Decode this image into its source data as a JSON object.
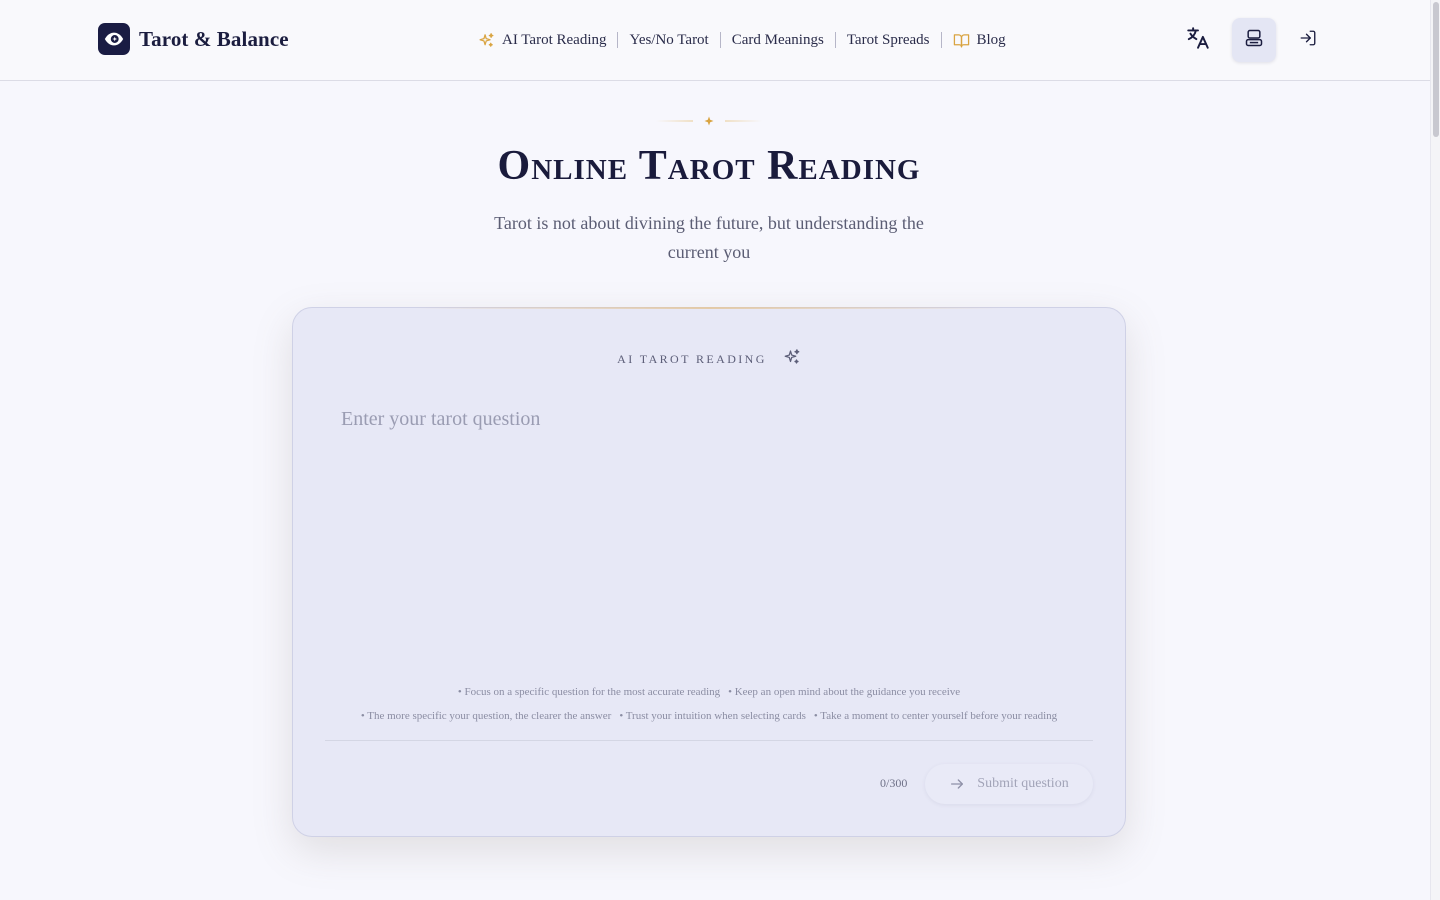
{
  "brand": {
    "name": "Tarot & Balance",
    "logo_icon": "eye-icon"
  },
  "nav": {
    "items": [
      {
        "label": "AI Tarot Reading",
        "icon": "sparkles-icon"
      },
      {
        "label": "Yes/No Tarot"
      },
      {
        "label": "Card Meanings"
      },
      {
        "label": "Tarot Spreads"
      },
      {
        "label": "Blog",
        "icon": "book-open-icon"
      }
    ]
  },
  "header_actions": [
    {
      "name": "language-button",
      "icon": "translate-icon"
    },
    {
      "name": "theme-button",
      "icon": "layout-icon",
      "active": true
    },
    {
      "name": "login-button",
      "icon": "log-in-icon"
    }
  ],
  "hero": {
    "title": "Online Tarot Reading",
    "subtitle": "Tarot is not about divining the future, but understanding the current you"
  },
  "reading_card": {
    "label": "AI Tarot Reading",
    "question_placeholder": "Enter your tarot question",
    "question_value": "",
    "tips_row1": [
      "• Focus on a specific question for the most accurate reading",
      "• Keep an open mind about the guidance you receive"
    ],
    "tips_row2": [
      "• The more specific your question, the clearer the answer",
      "• Trust your intuition when selecting cards",
      "• Take a moment to center yourself before your reading"
    ],
    "char_count": "0/300",
    "submit_label": "Submit question"
  },
  "colors": {
    "accent_gold": "#d9a441",
    "brand_navy": "#1a1c43",
    "card_bg": "#e7e8f6",
    "page_bg": "#f7f7fd"
  }
}
